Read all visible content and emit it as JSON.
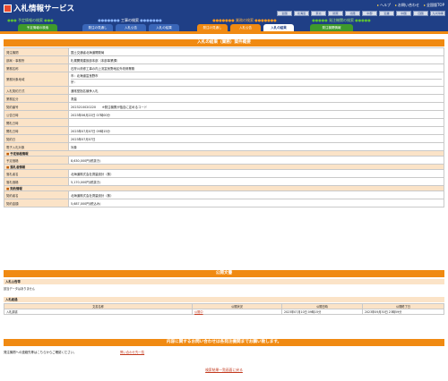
{
  "header": {
    "title": "入札情報サービス",
    "links": [
      "ヘルプ",
      "お問い合わせ",
      "全国版TOP"
    ],
    "regions": [
      "全国",
      "北海道",
      "東北",
      "関東",
      "北陸",
      "中部",
      "近畿",
      "中国",
      "四国",
      "九州沖縄"
    ],
    "categories": [
      {
        "label": "工事の検索",
        "color": "blue"
      },
      {
        "label": "業務の検索",
        "color": "orange"
      },
      {
        "label": "発注機関の検索",
        "color": "green"
      }
    ],
    "left_category": "予定情報の検索",
    "tabs": [
      {
        "label": "予定情報の検索",
        "style": "green"
      },
      {
        "label": "発注の見通し",
        "style": "blue"
      },
      {
        "label": "入札公告",
        "style": "blue"
      },
      {
        "label": "入札の結果",
        "style": "blue"
      },
      {
        "label": "発注の見通し",
        "style": "orange"
      },
      {
        "label": "入札公告",
        "style": "orange"
      },
      {
        "label": "入札の結果",
        "style": "active"
      },
      {
        "label": "発注機関情報",
        "style": "green"
      }
    ],
    "colors": {
      "navy": "#1f3f86",
      "orange": "#f08a12",
      "green": "#3f9a2b",
      "peach": "#fbe3c7"
    }
  },
  "detail": {
    "heading": "入札の結果（業務）案件概要",
    "rows": [
      {
        "k": "発注機関",
        "v": "国土交通省北海道開発局",
        "type": "row"
      },
      {
        "k": "部局・事務所",
        "v": "札幌開発建設部本部（本部事業課）",
        "type": "row"
      },
      {
        "k": "業務名称",
        "v": "石狩川改修工事の内上流富良野地区外改修業務",
        "type": "row"
      },
      {
        "k": "業務対象地域",
        "v": "市：北海道富良野市",
        "v2": "宗：",
        "type": "row2"
      },
      {
        "k": "入札契約方式",
        "v": "通常型指名競争入札",
        "type": "row"
      },
      {
        "k": "業務区分",
        "v": "測量",
        "type": "row"
      },
      {
        "k": "契約番号",
        "v": "2023210020220　　※発注機関が独自に定めるコード",
        "type": "row"
      },
      {
        "k": "公告日時",
        "v": "2023年06月22日 07時00分",
        "type": "row"
      },
      {
        "k": "開札日時",
        "v": "",
        "type": "row"
      },
      {
        "k": "開札日時",
        "v": "2023年07月07日 09時15分",
        "type": "row"
      },
      {
        "k": "契約日",
        "v": "2023年07月07日",
        "type": "row"
      },
      {
        "k": "電子入札対象",
        "v": "対象",
        "type": "row"
      },
      {
        "k": "予定価格情報",
        "type": "group"
      },
      {
        "k": "予定価格",
        "v": "8,630,000円(税抜き)",
        "type": "row"
      },
      {
        "k": "落札者情報",
        "type": "group"
      },
      {
        "k": "落札者名",
        "v": "北海道株式会社測量設計（株）",
        "type": "row"
      },
      {
        "k": "落札価格",
        "v": "5,170,000円(税抜き)",
        "type": "row"
      },
      {
        "k": "契約情報",
        "type": "group"
      },
      {
        "k": "契約者名",
        "v": "北海道株式会社測量設計（株）",
        "type": "row"
      },
      {
        "k": "契約金額",
        "v": "5,687,000円(税込み)",
        "type": "row"
      }
    ]
  },
  "public_docs": {
    "heading": "公開文書",
    "notice_label": "入札公告等",
    "notice_empty": "該当データはありません",
    "results_label": "入札経過",
    "columns": [
      "文書名称",
      "公開状況",
      "公開日時",
      "公開終了日"
    ],
    "rows": [
      {
        "name": "入札調書",
        "status": "公開中",
        "start": "2023年07月10日 09時15分",
        "end": "2023年09月30日 23時59分"
      }
    ]
  },
  "contact": {
    "heading": "内容に関するお問い合わせは各発注機関までお願い致します。",
    "left_text": "発注機関への連絡先等はこちらからご確認ください。",
    "link_text": "問い合わせ先一覧"
  },
  "footer": {
    "back_link": "検索結果一覧画面に戻る"
  }
}
